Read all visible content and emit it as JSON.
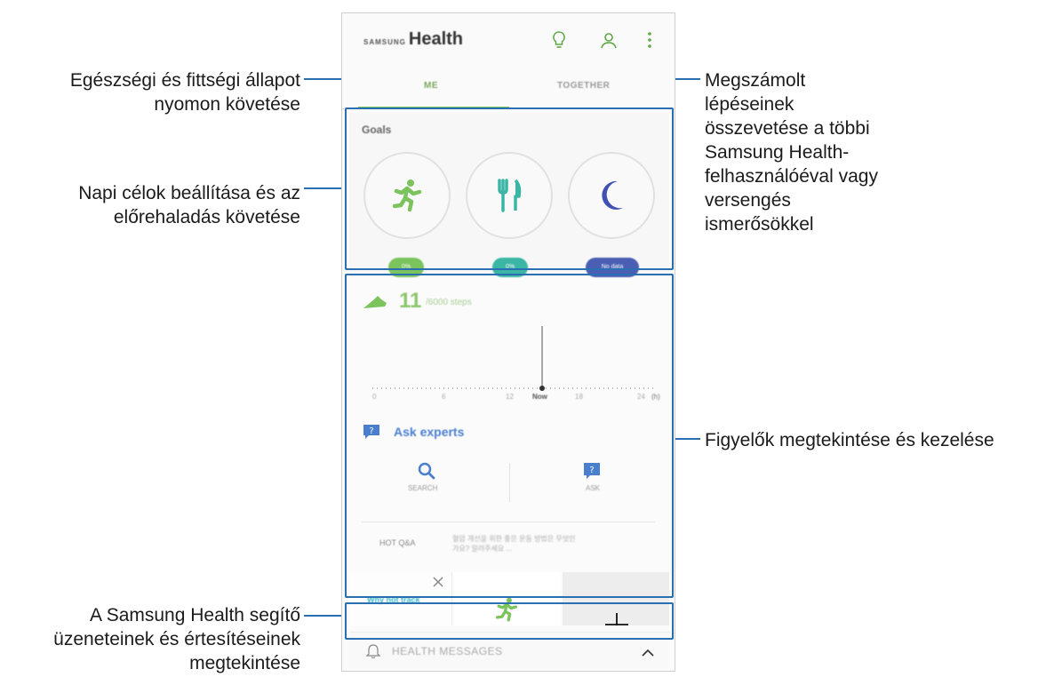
{
  "app": {
    "brand_small": "SAMSUNG",
    "brand_big": "Health",
    "icons": [
      "lightbulb-icon",
      "account-icon",
      "more-vert-icon"
    ]
  },
  "tabs": [
    {
      "label": "ME",
      "selected": true
    },
    {
      "label": "TOGETHER",
      "selected": false
    }
  ],
  "goals": {
    "title": "Goals",
    "items": [
      {
        "icon": "running-icon",
        "badge": "0%",
        "color": "#7bc35c"
      },
      {
        "icon": "fork-knife-icon",
        "badge": "0%",
        "color": "#3bb6a5"
      },
      {
        "icon": "moon-icon",
        "badge": "No data",
        "color": "#4a5fb3"
      }
    ]
  },
  "steps": {
    "count": "11",
    "goal": "/6000 steps",
    "ticks": [
      "0",
      "6",
      "12",
      "Now",
      "18",
      "24"
    ],
    "unit_suffix": "(h)"
  },
  "experts": {
    "title": "Ask experts",
    "search_label": "SEARCH",
    "ask_label": "ASK",
    "hot_label": "HOT Q&A",
    "hot_text": "혈압 개선을 위한 좋은 운동 방법은 무엇인가요? 알려주세요 ..."
  },
  "promo": {
    "text": "Why not track"
  },
  "messages": {
    "label": "HEALTH MESSAGES"
  },
  "callouts": {
    "me_tab": "Egészségi és fittségi állapot nyomon követése",
    "goals": "Napi célok beállítása és az előrehaladás követése",
    "messages": "A Samsung Health segítő üzeneteinek és értesítéseinek megtekintése",
    "together_tab": "Megszámolt lépéseinek összevetése a többi Samsung Health-felhasználóéval vagy versengés ismerősökkel",
    "trackers": "Figyelők megtekintése és kezelése"
  },
  "colors": {
    "accent_green": "#7bc35c",
    "teal": "#3bb6a5",
    "indigo": "#4a5fb3",
    "frame_blue": "#2b6fb3"
  }
}
